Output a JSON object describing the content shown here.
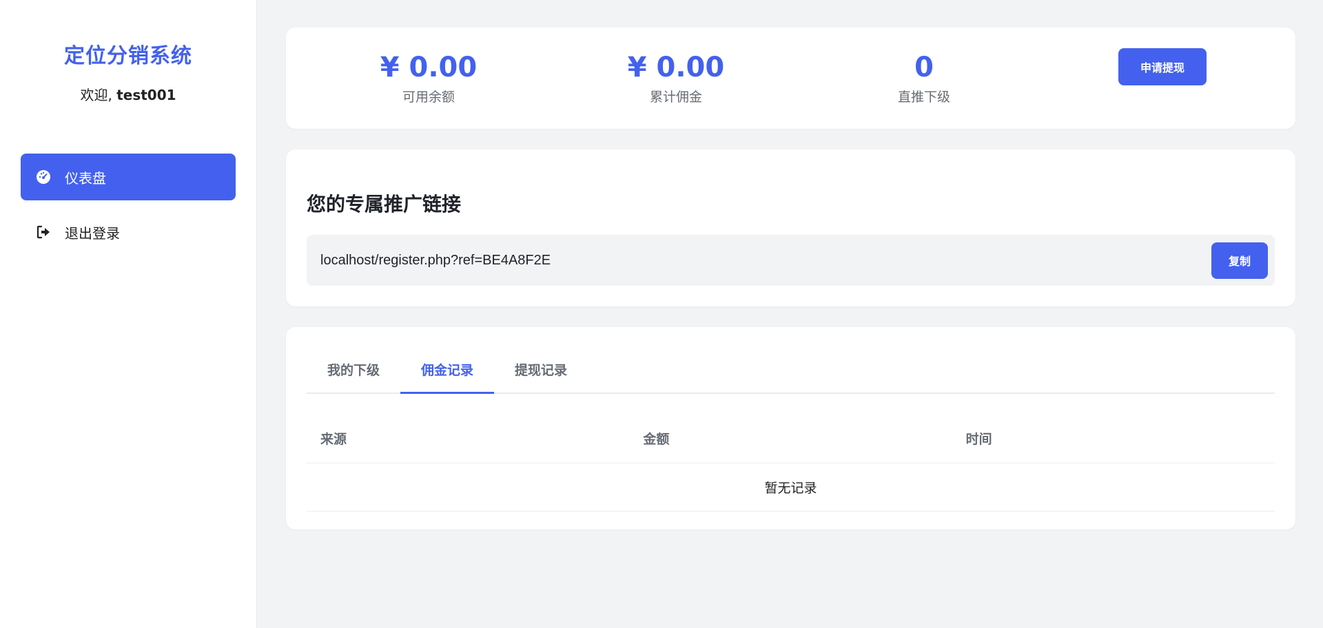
{
  "sidebar": {
    "brand": "定位分销系统",
    "welcome_prefix": "欢迎, ",
    "username": "test001",
    "items": [
      {
        "label": "仪表盘",
        "icon": "dashboard-icon",
        "active": true
      },
      {
        "label": "退出登录",
        "icon": "logout-icon",
        "active": false
      }
    ]
  },
  "stats": [
    {
      "value": "¥ 0.00",
      "label": "可用余额"
    },
    {
      "value": "¥ 0.00",
      "label": "累计佣金"
    },
    {
      "value": "0",
      "label": "直推下级"
    }
  ],
  "withdraw_button": "申请提现",
  "referral": {
    "title": "您的专属推广链接",
    "link": "localhost/register.php?ref=BE4A8F2E",
    "copy_label": "复制"
  },
  "records": {
    "tabs": [
      {
        "label": "我的下级",
        "active": false
      },
      {
        "label": "佣金记录",
        "active": true
      },
      {
        "label": "提现记录",
        "active": false
      }
    ],
    "columns": [
      "来源",
      "金额",
      "时间"
    ],
    "empty_text": "暂无记录"
  },
  "colors": {
    "accent": "#4361ee",
    "background": "#f2f3f5"
  }
}
